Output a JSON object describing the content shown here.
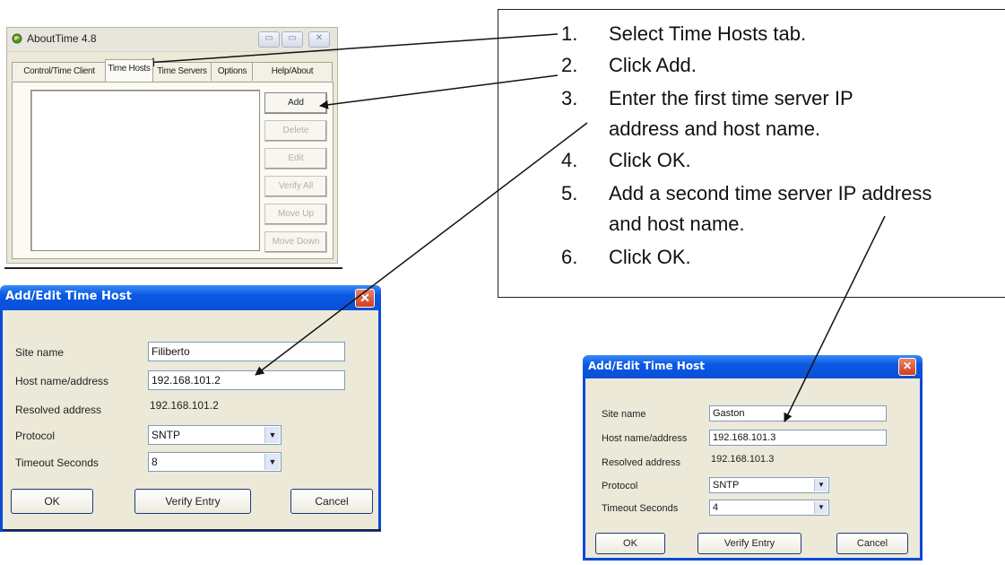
{
  "about_window": {
    "title": "AboutTime 4.8",
    "tabs": [
      "Control/Time Client",
      "Time Hosts",
      "Time Servers",
      "Options",
      "Help/About"
    ],
    "active_tab": "Time Hosts",
    "buttons": [
      {
        "label": "Add",
        "enabled": true
      },
      {
        "label": "Delete",
        "enabled": false
      },
      {
        "label": "Edit",
        "enabled": false
      },
      {
        "label": "Verify All",
        "enabled": false
      },
      {
        "label": "Move Up",
        "enabled": false
      },
      {
        "label": "Move Down",
        "enabled": false
      }
    ]
  },
  "dialog1": {
    "title": "Add/Edit Time Host",
    "site_name_label": "Site name",
    "site_name_value": "Filiberto",
    "host_label": "Host name/address",
    "host_value": "192.168.101.2",
    "resolved_label": "Resolved address",
    "resolved_value": "192.168.101.2",
    "protocol_label": "Protocol",
    "protocol_value": "SNTP",
    "timeout_label": "Timeout Seconds",
    "timeout_value": "8",
    "ok_label": "OK",
    "verify_label": "Verify Entry",
    "cancel_label": "Cancel",
    "close_glyph": "✕"
  },
  "dialog2": {
    "title": "Add/Edit Time Host",
    "site_name_label": "Site name",
    "site_name_value": "Gaston",
    "host_label": "Host name/address",
    "host_value": "192.168.101.3",
    "resolved_label": "Resolved address",
    "resolved_value": "192.168.101.3",
    "protocol_label": "Protocol",
    "protocol_value": "SNTP",
    "timeout_label": "Timeout Seconds",
    "timeout_value": "4",
    "ok_label": "OK",
    "verify_label": "Verify Entry",
    "cancel_label": "Cancel",
    "close_glyph": "✕"
  },
  "instructions": [
    {
      "num": "1.",
      "lines": [
        "Select Time Hosts tab."
      ]
    },
    {
      "num": "2.",
      "lines": [
        "Click Add."
      ]
    },
    {
      "num": "3.",
      "lines": [
        "Enter the first time server IP",
        "address and host name."
      ]
    },
    {
      "num": "4.",
      "lines": [
        "Click OK."
      ]
    },
    {
      "num": "5.",
      "lines": [
        "Add a second time server IP address",
        "and host name."
      ]
    },
    {
      "num": "6.",
      "lines": [
        "Click OK."
      ]
    }
  ],
  "colors": {
    "xp_title_blue": "#0b4fd7",
    "dialog_face": "#ece9d8",
    "close_red": "#cf3f1c"
  },
  "icons": {
    "app": "globe-icon",
    "close": "close-icon",
    "dropdown": "chevron-down-icon"
  },
  "dropdown_glyph": "▼",
  "window_glyphs": {
    "minimize": "▭",
    "maximize": "▭",
    "close": "✕"
  }
}
